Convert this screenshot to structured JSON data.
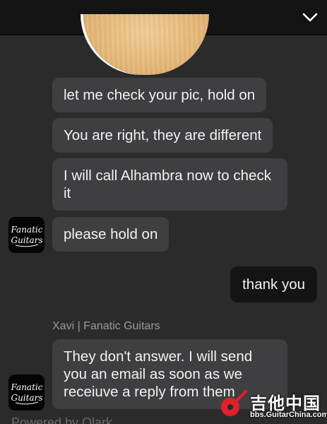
{
  "header": {
    "collapse_icon": "chevron-down-icon"
  },
  "messages": {
    "m1": "let me check your pic, hold on",
    "m2": "You are right, they are different",
    "m3": "I will call Alhambra now to check it",
    "m4": "please hold on",
    "outgoing": "thank you",
    "m5": "They don't answer. I will send you an email as soon as we receiuve a reply from them"
  },
  "agent": {
    "label": "Xavi | Fanatic Guitars",
    "avatar_text": "Fanatic Guitars"
  },
  "watermark": {
    "chinese": "吉他中国",
    "url": "bbs.GuitarChina.com"
  },
  "footer": {
    "powered_by": "Powered by Olark"
  },
  "colors": {
    "background": "#2b2b2b",
    "topbar": "#141414",
    "incoming_bubble": "#3f3f41",
    "outgoing_bubble": "#141414",
    "watermark_red": "#e0202a"
  }
}
